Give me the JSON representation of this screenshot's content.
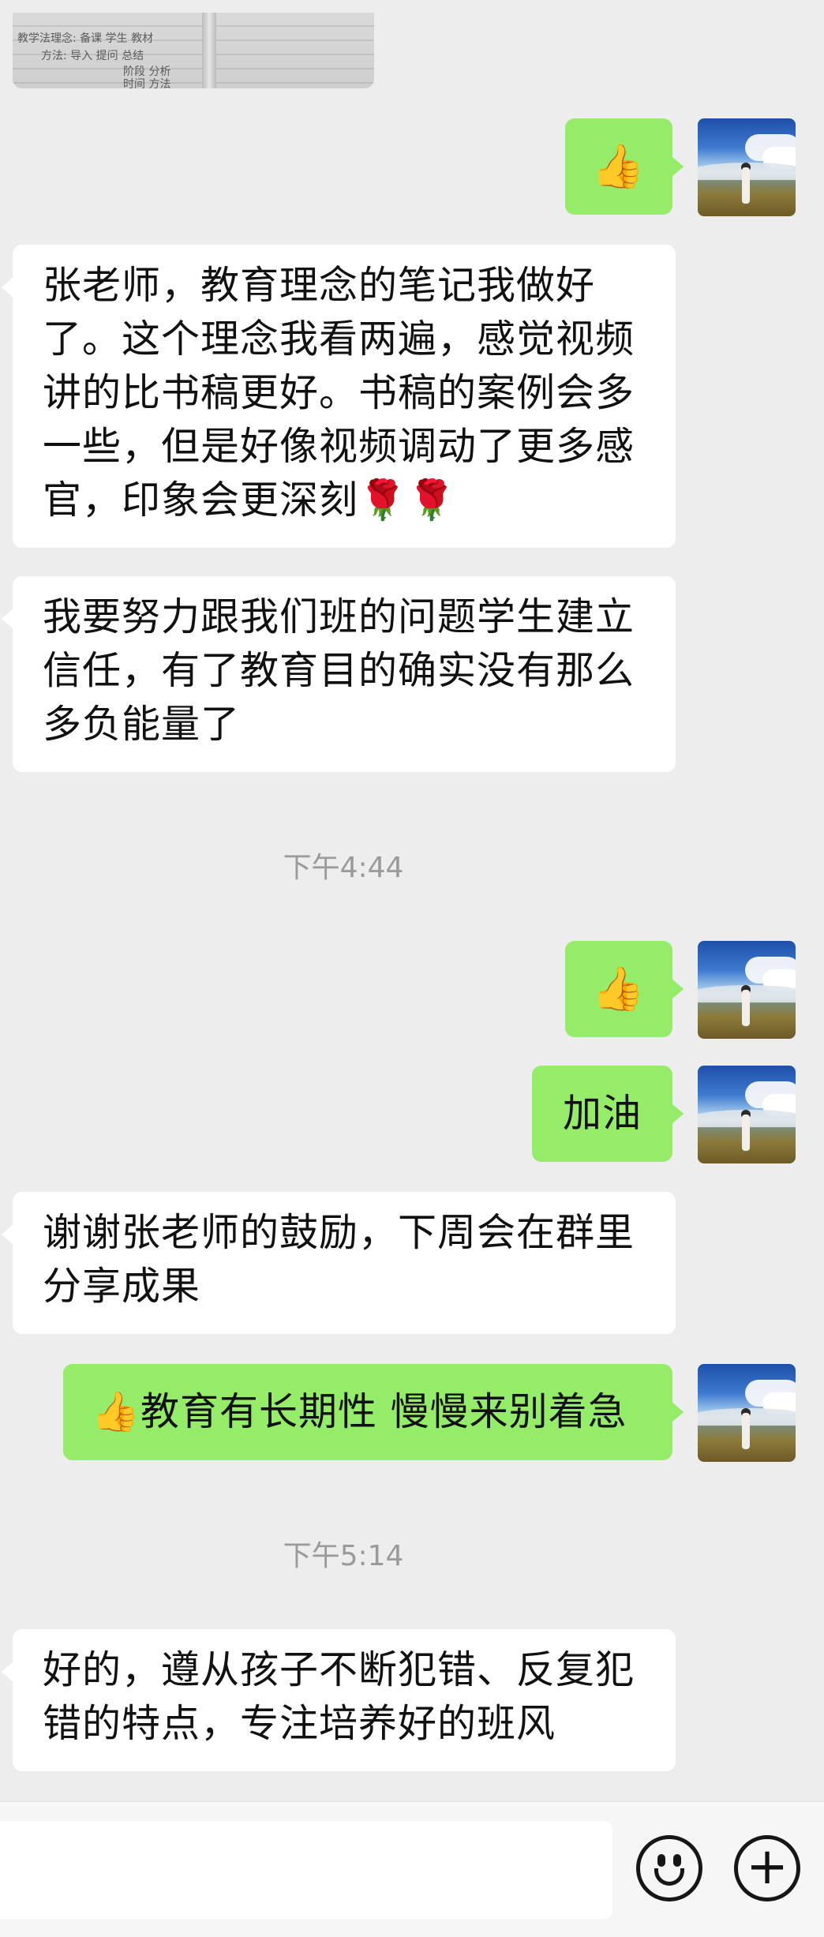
{
  "top_image": {
    "scribbles": [
      "教学法理念: 备课 学生 教材",
      "方法: 导入 提问 总结",
      "阶段  分析",
      "时间  方法"
    ]
  },
  "messages": [
    {
      "id": "m1",
      "side": "right",
      "text": "👍"
    },
    {
      "id": "m2",
      "side": "left",
      "text": "张老师，教育理念的笔记我做好了。这个理念我看两遍，感觉视频讲的比书稿更好。书稿的案例会多一些，但是好像视频调动了更多感官，印象会更深刻🌹🌹"
    },
    {
      "id": "m3",
      "side": "left",
      "text": "我要努力跟我们班的问题学生建立信任，有了教育目的确实没有那么多负能量了"
    },
    {
      "id": "ts1",
      "type": "timestamp",
      "text": "下午4:44"
    },
    {
      "id": "m4",
      "side": "right",
      "text": "👍"
    },
    {
      "id": "m5",
      "side": "right",
      "text": "加油"
    },
    {
      "id": "m6",
      "side": "left",
      "text": "谢谢张老师的鼓励，下周会在群里分享成果"
    },
    {
      "id": "m7",
      "side": "right",
      "text": "👍教育有长期性 慢慢来别着急"
    },
    {
      "id": "ts2",
      "type": "timestamp",
      "text": "下午5:14"
    },
    {
      "id": "m8",
      "side": "left",
      "text": "好的，遵从孩子不断犯错、反复犯错的特点，专注培养好的班风"
    }
  ],
  "input_bar": {
    "emoji_icon": "smiley-face-icon",
    "plus_icon": "plus-circle-icon",
    "plus_glyph": "+"
  },
  "colors": {
    "background": "#ededed",
    "bubble_self": "#95ec69",
    "bubble_other": "#ffffff",
    "timestamp": "#9a9a9a"
  }
}
